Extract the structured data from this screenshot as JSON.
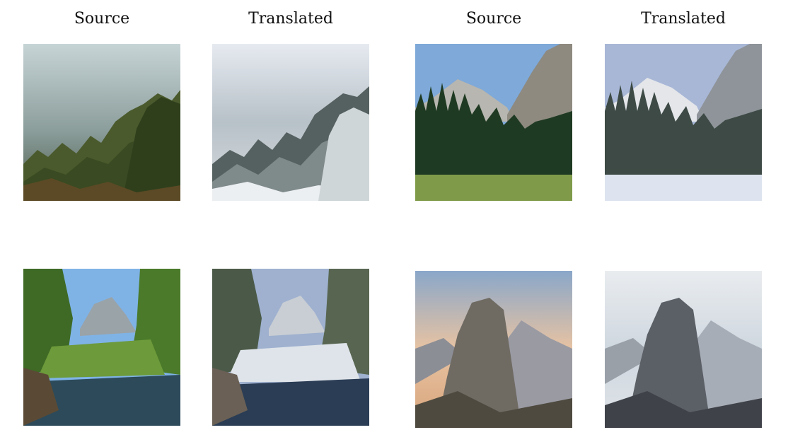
{
  "headers": [
    "Source",
    "Translated",
    "Source",
    "Translated"
  ],
  "panels": [
    {
      "row": 1,
      "col": 1,
      "label": "Source",
      "scene": "misty pine forest"
    },
    {
      "row": 1,
      "col": 2,
      "label": "Translated",
      "scene": "snow-covered misty pine forest"
    },
    {
      "row": 1,
      "col": 3,
      "label": "Source",
      "scene": "mountain valley with meadow"
    },
    {
      "row": 1,
      "col": 4,
      "label": "Translated",
      "scene": "snowy mountain valley"
    },
    {
      "row": 2,
      "col": 1,
      "label": "Source",
      "scene": "forest lake with cliff"
    },
    {
      "row": 2,
      "col": 2,
      "label": "Translated",
      "scene": "snowy forest lake with cliff"
    },
    {
      "row": 2,
      "col": 3,
      "label": "Source",
      "scene": "granite dome at sunset"
    },
    {
      "row": 2,
      "col": 4,
      "label": "Translated",
      "scene": "snowy granite dome"
    }
  ]
}
